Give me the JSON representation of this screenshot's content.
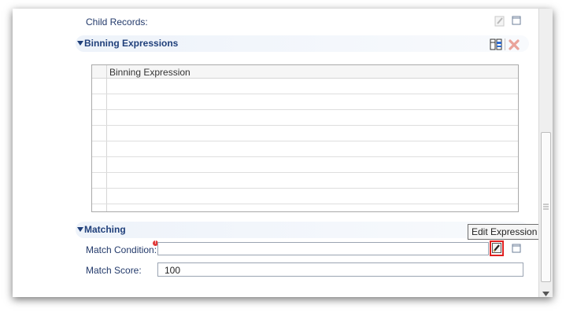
{
  "child_records": {
    "label": "Child Records:"
  },
  "binning": {
    "title": "Binning Expressions",
    "grid": {
      "header": "Binning Expression"
    }
  },
  "matching": {
    "title": "Matching",
    "match_condition": {
      "label": "Match Condition:",
      "value": ""
    },
    "match_score": {
      "label": "Match Score:",
      "value": "100"
    }
  },
  "tooltip": {
    "text": "Edit Expression"
  },
  "colors": {
    "section_title": "#1f3f7a",
    "label": "#233a6b",
    "highlight_border": "#e02020"
  }
}
